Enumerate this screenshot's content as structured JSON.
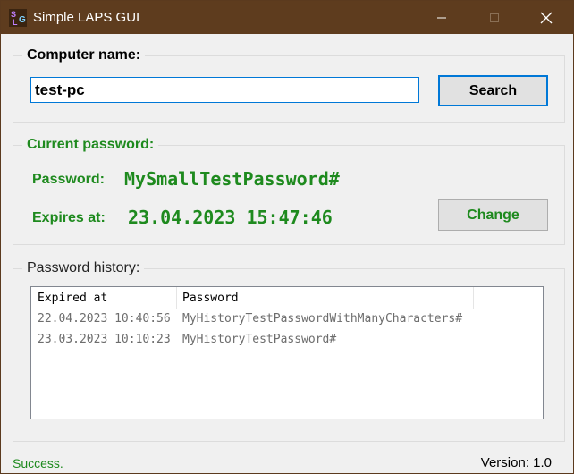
{
  "window": {
    "title": "Simple LAPS GUI",
    "icon_text_top": "S",
    "icon_text_bottom": "G"
  },
  "computer": {
    "legend": "Computer name:",
    "value": "test-pc",
    "search_label": "Search"
  },
  "current": {
    "legend": "Current password:",
    "password_label": "Password:",
    "password_value": "MySmallTestPassword#",
    "expires_label": "Expires at:",
    "expires_value": "23.04.2023 15:47:46",
    "change_label": "Change"
  },
  "history": {
    "legend": "Password history:",
    "columns": [
      "Expired at",
      "Password"
    ],
    "rows": [
      {
        "expired": "22.04.2023 10:40:56",
        "password": "MyHistoryTestPasswordWithManyCharacters#"
      },
      {
        "expired": "23.03.2023 10:10:23",
        "password": "MyHistoryTestPassword#"
      }
    ]
  },
  "status": {
    "message": "Success.",
    "version": "Version: 1.0"
  },
  "colors": {
    "titlebar": "#5e3c1e",
    "accent_green": "#1e8a1e",
    "focus_blue": "#0078d7"
  }
}
